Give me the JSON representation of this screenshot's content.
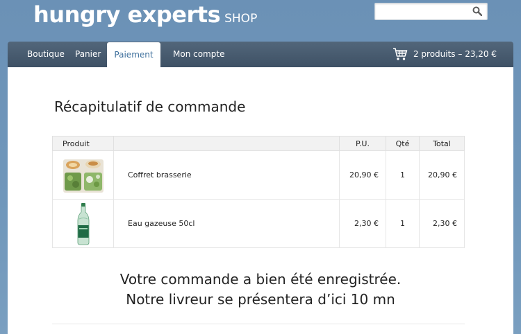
{
  "brand": {
    "name": "hungry experts",
    "suffix": "SHOP"
  },
  "search": {
    "value": "",
    "placeholder": ""
  },
  "nav": {
    "items": [
      {
        "label": "Boutique",
        "active": false
      },
      {
        "label": "Panier",
        "active": false
      },
      {
        "label": "Paiement",
        "active": true
      },
      {
        "label": "Mon compte",
        "active": false
      }
    ]
  },
  "cart": {
    "summary": "2 produits – 23,20 €"
  },
  "summary": {
    "title": "Récapitulatif de commande",
    "columns": {
      "product": "Produit",
      "name": "",
      "unit_price": "P.U.",
      "qty": "Qté",
      "total": "Total"
    },
    "rows": [
      {
        "image": "lunch-box-image",
        "name": "Coffret brasserie",
        "unit_price": "20,90 €",
        "qty": "1",
        "total": "20,90 €"
      },
      {
        "image": "water-bottle-image",
        "name": "Eau gazeuse 50cl",
        "unit_price": "2,30 €",
        "qty": "1",
        "total": "2,30 €"
      }
    ]
  },
  "confirmation": {
    "line1": "Votre commande a bien été enregistrée.",
    "line2": "Notre livreur se présentera d’ici 10 mn"
  },
  "colors": {
    "background": "#6e94b8",
    "navbar": "#46596d",
    "active_tab_text": "#3d6f9c"
  }
}
